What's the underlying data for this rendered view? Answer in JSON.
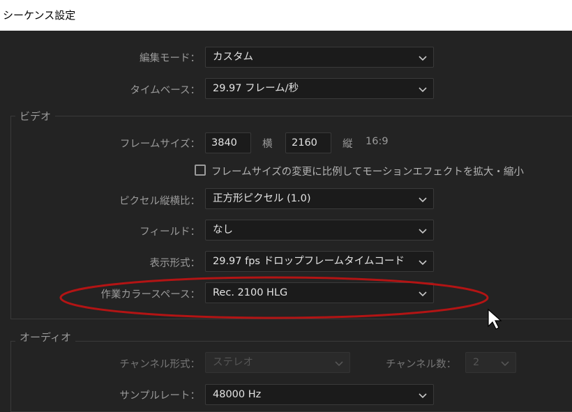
{
  "window": {
    "title": "シーケンス設定"
  },
  "general": {
    "editing_mode": {
      "label": "編集モード：",
      "value": "カスタム"
    },
    "timebase": {
      "label": "タイムベース：",
      "value": "29.97  フレーム/秒"
    }
  },
  "video": {
    "group_title": "ビデオ",
    "frame_size": {
      "label": "フレームサイズ：",
      "width": "3840",
      "width_unit": "横",
      "height": "2160",
      "height_unit": "縦",
      "aspect": "16:9"
    },
    "scale_checkbox": {
      "label": "フレームサイズの変更に比例してモーションエフェクトを拡大・縮小",
      "checked": false
    },
    "pixel_aspect": {
      "label": "ピクセル縦横比：",
      "value": "正方形ピクセル (1.0)"
    },
    "fields": {
      "label": "フィールド：",
      "value": "なし"
    },
    "display_format": {
      "label": "表示形式：",
      "value": "29.97  fps  ドロップフレームタイムコード"
    },
    "working_color_space": {
      "label": "作業カラースペース：",
      "value": "Rec. 2100 HLG"
    }
  },
  "audio": {
    "group_title": "オーディオ",
    "channel_format": {
      "label": "チャンネル形式：",
      "value": "ステレオ"
    },
    "channel_count": {
      "label": "チャンネル数：",
      "value": "2"
    },
    "sample_rate": {
      "label": "サンプルレート：",
      "value": "48000 Hz"
    }
  },
  "colors": {
    "annotation_ellipse": "#b31414",
    "panel_bg": "#232323"
  }
}
